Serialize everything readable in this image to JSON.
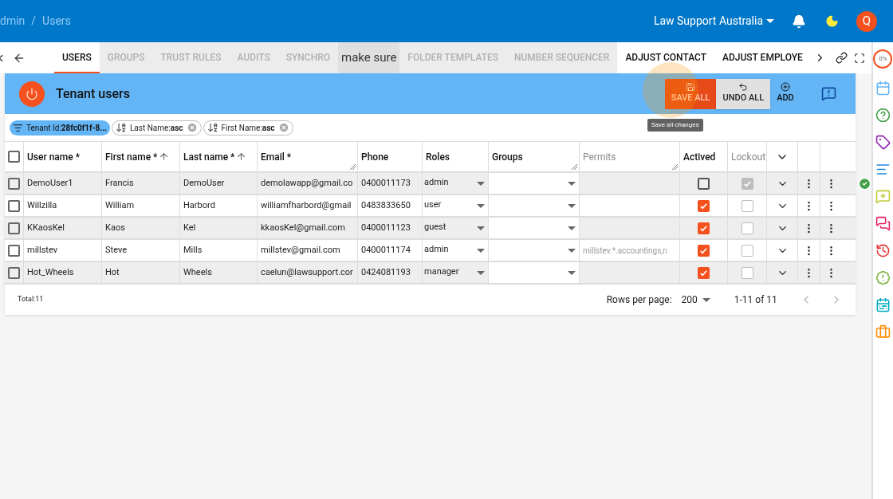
{
  "breadcrumb": {
    "items": [
      "dmin",
      "Users"
    ],
    "separator": "/"
  },
  "org": {
    "name": "Law Support Australia"
  },
  "avatar": {
    "initial": "Q"
  },
  "tabs": [
    {
      "label": "USERS",
      "selected": true,
      "dimmed": false
    },
    {
      "label": "GROUPS",
      "selected": false,
      "dimmed": true
    },
    {
      "label": "TRUST RULES",
      "selected": false,
      "dimmed": true
    },
    {
      "label": "AUDITS",
      "selected": false,
      "dimmed": true
    },
    {
      "label": "SYNCHRO",
      "selected": false,
      "dimmed": true
    },
    {
      "label": "FOLDER TEMPLATES",
      "selected": false,
      "dimmed": true
    },
    {
      "label": "NUMBER SEQUENCER",
      "selected": false,
      "dimmed": true
    },
    {
      "label": "ADJUST CONTACT",
      "selected": false,
      "dimmed": false
    },
    {
      "label": "ADJUST EMPLOYE",
      "selected": false,
      "dimmed": false
    }
  ],
  "overlay_caption": "make sure",
  "panel": {
    "title": "Tenant users",
    "actions": [
      {
        "kind": "save",
        "label": "SAVE ALL"
      },
      {
        "kind": "undo",
        "label": "UNDO ALL"
      },
      {
        "kind": "add",
        "label": "ADD"
      }
    ],
    "tooltip": "Save all changes"
  },
  "chips": [
    {
      "kind": "filter",
      "label": "Tenant Id:",
      "value": "28fc0f1f-8..."
    },
    {
      "kind": "sort",
      "label": "Last Name:",
      "value": "asc"
    },
    {
      "kind": "sort",
      "label": "First Name:",
      "value": "asc"
    }
  ],
  "table": {
    "all_selected": false,
    "columns": [
      {
        "label": "User name *",
        "sorted": false,
        "muted": false,
        "resizable": false
      },
      {
        "label": "First name *",
        "sorted": true,
        "muted": false,
        "resizable": false
      },
      {
        "label": "Last name *",
        "sorted": true,
        "muted": false,
        "resizable": false
      },
      {
        "label": "Email *",
        "sorted": false,
        "muted": false,
        "resizable": true
      },
      {
        "label": "Phone",
        "sorted": false,
        "muted": false,
        "resizable": false
      },
      {
        "label": "Roles",
        "sorted": false,
        "muted": false,
        "resizable": false
      },
      {
        "label": "Groups",
        "sorted": false,
        "muted": false,
        "resizable": true
      },
      {
        "label": "Permits",
        "sorted": false,
        "muted": true,
        "resizable": true
      },
      {
        "label": "Actived",
        "sorted": false,
        "muted": false,
        "resizable": false
      },
      {
        "label": "Lockout",
        "sorted": false,
        "muted": true,
        "resizable": false
      }
    ],
    "rows": [
      {
        "selected": false,
        "username": "DemoUser1",
        "first": "Francis",
        "last": "DemoUser",
        "email": "demolawapp@gmail.co",
        "phone": "0400011173",
        "role": "admin",
        "actived": false,
        "lockout": true,
        "saved": true
      },
      {
        "selected": false,
        "username": "Willzilla",
        "first": "William",
        "last": "Harbord",
        "email": "williamfharbord@gmail",
        "phone": "0483833650",
        "role": "user",
        "actived": true,
        "lockout": false,
        "saved": false
      },
      {
        "selected": false,
        "username": "KKaosKel",
        "first": "Kaos",
        "last": "Kel",
        "email": "kkaosKel@gmail.com",
        "phone": "0400011123",
        "role": "guest",
        "actived": true,
        "lockout": false,
        "saved": false
      },
      {
        "selected": false,
        "username": "millstev",
        "first": "Steve",
        "last": "Mills",
        "email": "millstev@gmail.com",
        "phone": "0400011174",
        "role": "admin",
        "permits": "millstev.*.accountings,n",
        "actived": true,
        "lockout": false,
        "saved": false
      },
      {
        "selected": false,
        "username": "Hot_Wheels",
        "first": "Hot",
        "last": "Wheels",
        "email": "caelun@lawsupport.cor",
        "phone": "0424081193",
        "role": "manager",
        "actived": true,
        "lockout": false,
        "saved": false
      }
    ]
  },
  "footer": {
    "total": "Total:11",
    "rows_per_page_label": "Rows per page:",
    "rows_per_page": "200",
    "range": "1-11 of 11"
  },
  "rail": {
    "progress": "0%"
  }
}
